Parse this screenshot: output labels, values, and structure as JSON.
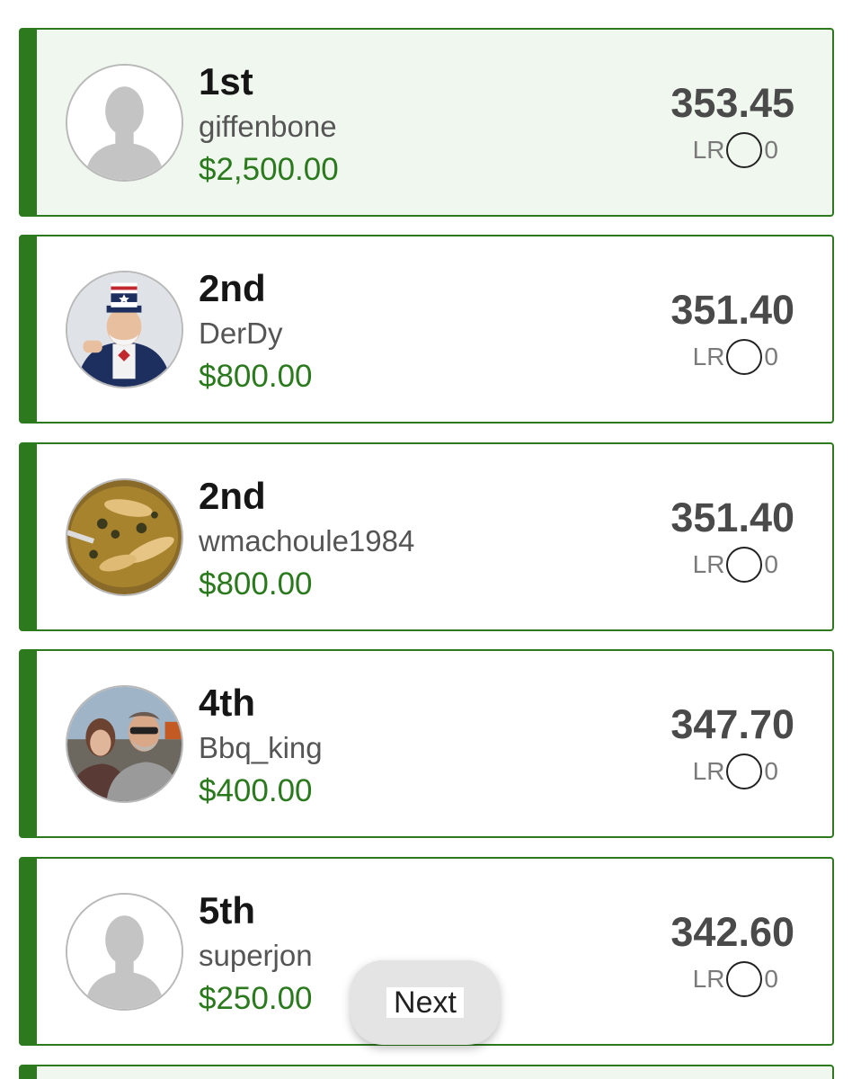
{
  "entries": [
    {
      "rank": "1st",
      "username": "giffenbone",
      "prize": "$2,500.00",
      "score": "353.45",
      "lr_label": "LR",
      "lr_value": "0",
      "avatar": "default-avatar",
      "highlight": true
    },
    {
      "rank": "2nd",
      "username": "DerDy",
      "prize": "$800.00",
      "score": "351.40",
      "lr_label": "LR",
      "lr_value": "0",
      "avatar": "uncle-sam-avatar",
      "highlight": false
    },
    {
      "rank": "2nd",
      "username": "wmachoule1984",
      "prize": "$800.00",
      "score": "351.40",
      "lr_label": "LR",
      "lr_value": "0",
      "avatar": "food-photo-avatar",
      "highlight": false
    },
    {
      "rank": "4th",
      "username": "Bbq_king",
      "prize": "$400.00",
      "score": "347.70",
      "lr_label": "LR",
      "lr_value": "0",
      "avatar": "couple-photo-avatar",
      "highlight": false
    },
    {
      "rank": "5th",
      "username": "superjon",
      "prize": "$250.00",
      "score": "342.60",
      "lr_label": "LR",
      "lr_value": "0",
      "avatar": "default-avatar",
      "highlight": false
    }
  ],
  "next_button": {
    "label": "Next"
  },
  "colors": {
    "accent": "#2d7a1e",
    "prize": "#2a7a1d",
    "highlight_bg": "#f0f7ef"
  }
}
